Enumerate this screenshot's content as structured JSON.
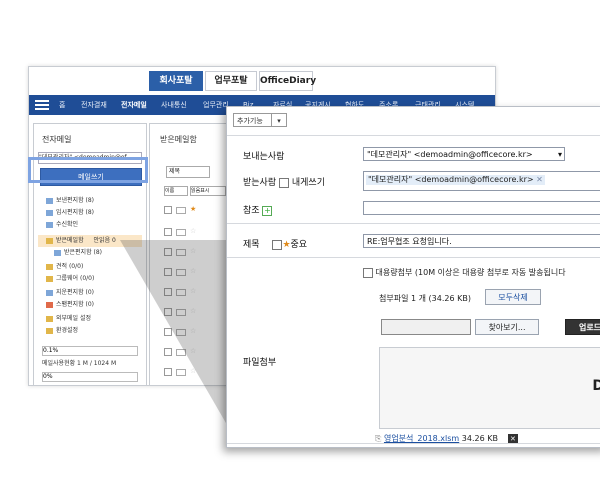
{
  "portal_tabs": [
    "회사포탈",
    "업무포탈",
    "OfficeDiary"
  ],
  "nav": [
    "홈",
    "전자결재",
    "전자메일",
    "사내통신",
    "업무관리",
    "Biz",
    "자료실",
    "공지게시",
    "협하도",
    "주소록",
    "근태관리",
    "시스템"
  ],
  "left": {
    "title": "전자메일",
    "account": "\"데모관리자\" <demoadmin@of",
    "compose": "메일쓰기",
    "folders": [
      {
        "label": "보낸편지함 (8)"
      },
      {
        "label": "임시편지함 (8)"
      },
      {
        "label": "수신확인"
      },
      {
        "label": "받은메일함"
      },
      {
        "label": "받은편지함 (8)"
      },
      {
        "label": "견적 (0/0)"
      },
      {
        "label": "그룹웨어 (0/0)"
      },
      {
        "label": "지운편지함 (0)"
      },
      {
        "label": "스팸편지함 (0)"
      },
      {
        "label": "외부메일 설정"
      },
      {
        "label": "환경설정"
      }
    ],
    "inbox_badge": "안읽음 0",
    "usage_pct": "0.1%",
    "usage_text": "메일사용현황 1 M / 1024 M",
    "usage_pct2": "0%"
  },
  "inbox": {
    "title": "받은메일함",
    "filter": "제목",
    "sort": "이름",
    "sort2": "읽음표시"
  },
  "compose": {
    "addon": "추가기능",
    "from_label": "보내는사람",
    "from_value": "\"데모관리자\" <demoadmin@officecore.kr>",
    "to_label": "받는사람",
    "self_label": "내게쓰기",
    "to_value": "\"데모관리자\" <demoadmin@officecore.kr>",
    "cc_label": "참조",
    "subject_label": "제목",
    "important_label": "중요",
    "subject_value": "RE:업무협조 요청입니다.",
    "attach_label": "파일첨부",
    "bulk_text": "대용량첨부 (10M 이상은 대용량 첨부로 자동 발송됩니다",
    "file_count": "첨부파일 1 개 (34.26 KB)",
    "delete_all": "모두삭제",
    "browse": "찾아보기...",
    "upload": "업로드",
    "dz_glyph": "D",
    "file_name": "영업분석_2018.xlsm",
    "file_size": "34.26 KB"
  }
}
